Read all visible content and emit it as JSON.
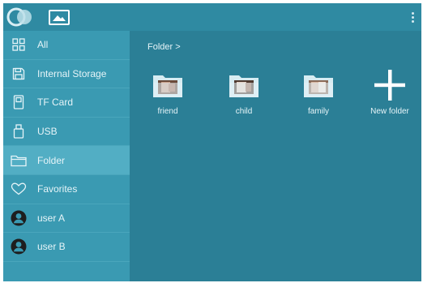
{
  "sidebar": {
    "items": [
      {
        "label": "All"
      },
      {
        "label": "Internal Storage"
      },
      {
        "label": "TF Card"
      },
      {
        "label": "USB"
      },
      {
        "label": "Folder"
      },
      {
        "label": "Favorites"
      },
      {
        "label": "user A"
      },
      {
        "label": "user B"
      }
    ],
    "active": "Folder"
  },
  "main": {
    "breadcrumb": "Folder >",
    "tiles": [
      {
        "label": "friend"
      },
      {
        "label": "child"
      },
      {
        "label": "family"
      },
      {
        "label": "New folder"
      }
    ]
  },
  "colors": {
    "background": "#2b7f96",
    "topbar": "#2f8aa2",
    "sidebar": "#3a9ab2",
    "sidebar_active": "#52aec4",
    "text": "#e6f4f8",
    "folder": "#d6ecf2"
  },
  "icons": {
    "topbar": [
      "app-logo-icon",
      "gallery-icon",
      "more-vert-icon"
    ],
    "sidebar": [
      "grid-icon",
      "save-icon",
      "sd-card-icon",
      "usb-icon",
      "folder-icon",
      "heart-icon",
      "user-avatar-icon",
      "user-avatar-icon"
    ],
    "tiles": [
      "photo-folder-icon",
      "photo-folder-icon",
      "photo-folder-icon",
      "plus-icon"
    ]
  }
}
